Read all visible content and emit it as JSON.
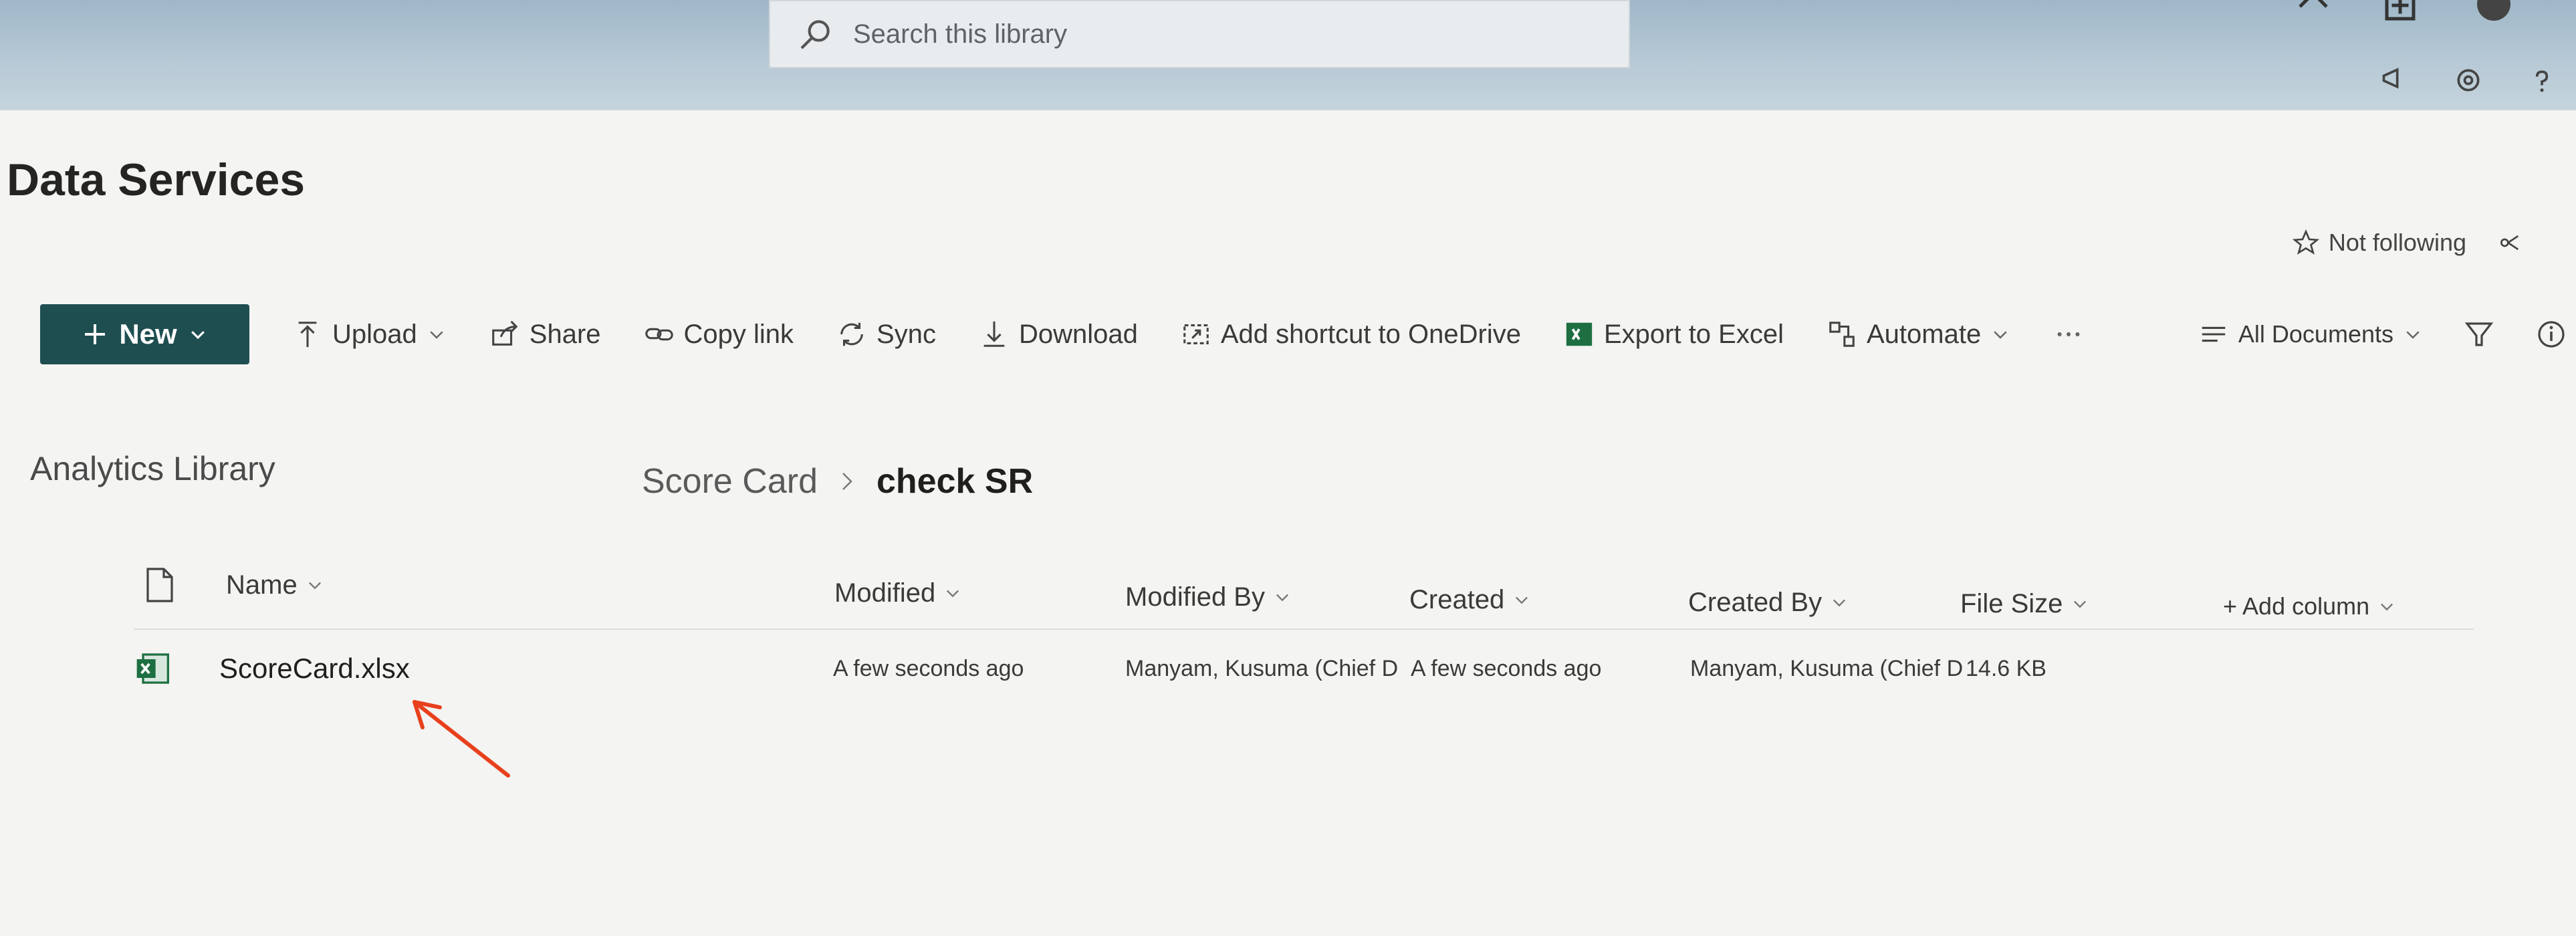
{
  "search": {
    "placeholder": "Search this library"
  },
  "site": {
    "title": "Data Services",
    "follow_label": "Not following"
  },
  "commands": {
    "new_label": "New",
    "upload": "Upload",
    "share": "Share",
    "copy_link": "Copy link",
    "sync": "Sync",
    "download": "Download",
    "add_shortcut": "Add shortcut to OneDrive",
    "export_excel": "Export to Excel",
    "automate": "Automate",
    "view": "All Documents"
  },
  "library": {
    "name": "Analytics Library"
  },
  "breadcrumb": {
    "parent": "Score Card",
    "current": "check SR"
  },
  "table": {
    "columns": {
      "name": "Name",
      "modified": "Modified",
      "modified_by": "Modified By",
      "created": "Created",
      "created_by": "Created By",
      "file_size": "File Size",
      "add_column": "+ Add column"
    },
    "rows": [
      {
        "name": "ScoreCard.xlsx",
        "modified": "A few seconds ago",
        "modified_by": "Manyam, Kusuma (Chief D",
        "created": "A few seconds ago",
        "created_by": "Manyam, Kusuma (Chief D",
        "file_size": "14.6 KB"
      }
    ]
  },
  "colors": {
    "new_button": "#1e4e50",
    "excel_green": "#1d6f42",
    "annotation": "#e8401c"
  }
}
